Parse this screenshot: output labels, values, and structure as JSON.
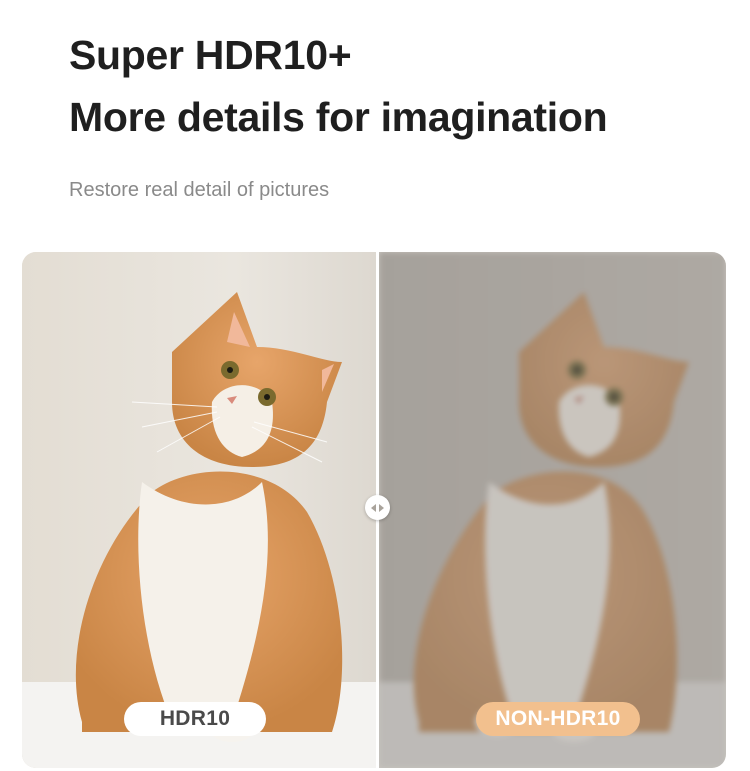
{
  "header": {
    "title_line1": "Super HDR10+",
    "title_line2": "More details for imagination",
    "subtitle": "Restore real detail of pictures"
  },
  "comparison": {
    "left_label": "HDR10",
    "right_label": "NON-HDR10",
    "slider_icon": "left-right-arrows-icon",
    "photo_subject": "orange-and-white-cat-photo",
    "colors": {
      "non_hdr_badge": "#f2c08e",
      "hdr_badge": "#ffffff"
    }
  }
}
